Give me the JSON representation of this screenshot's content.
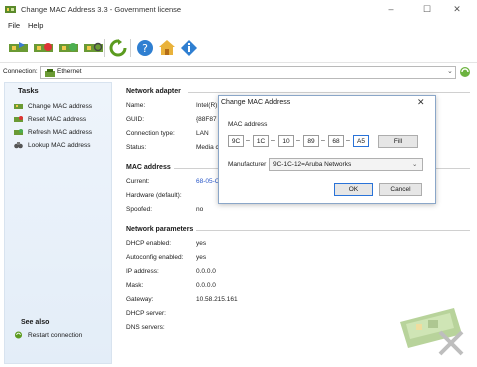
{
  "window": {
    "title": "Change MAC Address 3.3 - Government license",
    "minimize": "–",
    "maximize": "☐",
    "close": "✕"
  },
  "menu": [
    "File",
    "Help"
  ],
  "connection": {
    "label": "Connection:",
    "value": "Ethernet"
  },
  "tasks": {
    "title": "Tasks",
    "items": [
      "Change MAC address",
      "Reset MAC address",
      "Refresh MAC address",
      "Lookup MAC address"
    ],
    "see_also_title": "See also",
    "see_also_items": [
      "Restart connection"
    ]
  },
  "network_adapter": {
    "heading": "Network adapter",
    "rows": [
      {
        "label": "Name:",
        "value": "Intel(R)"
      },
      {
        "label": "GUID:",
        "value": "{88F87"
      },
      {
        "label": "Connection type:",
        "value": "LAN"
      },
      {
        "label": "Status:",
        "value": "Media c"
      }
    ]
  },
  "mac_address": {
    "heading": "MAC address",
    "rows": [
      {
        "label": "Current:",
        "value": "68-05-C"
      },
      {
        "label": "Hardware (default):",
        "value": ""
      },
      {
        "label": "Spoofed:",
        "value": "no"
      }
    ]
  },
  "network_parameters": {
    "heading": "Network parameters",
    "rows": [
      {
        "label": "DHCP enabled:",
        "value": "yes"
      },
      {
        "label": "Autoconfig enabled:",
        "value": "yes"
      },
      {
        "label": "IP address:",
        "value": "0.0.0.0"
      },
      {
        "label": "Mask:",
        "value": "0.0.0.0"
      },
      {
        "label": "Gateway:",
        "value": "10.58.215.161"
      },
      {
        "label": "DHCP server:",
        "value": ""
      },
      {
        "label": "DNS servers:",
        "value": ""
      }
    ]
  },
  "dialog": {
    "title": "Change MAC Address",
    "close": "✕",
    "group_label": "MAC address",
    "octets": [
      "9C",
      "1C",
      "10",
      "89",
      "68",
      "A5"
    ],
    "separator": "–",
    "fill_button": "Fill",
    "manufacturer_label": "Manufacturer",
    "manufacturer_value": "9C-1C-12=Aruba Networks",
    "ok_button": "OK",
    "cancel_button": "Cancel"
  },
  "colors": {
    "accent": "#2a73d8",
    "link": "#2a58c8",
    "tasks_bg": "#e9f1fa"
  }
}
